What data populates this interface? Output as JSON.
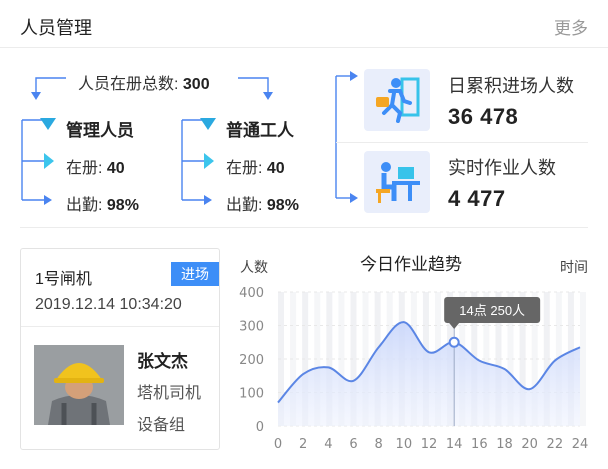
{
  "header": {
    "title": "人员管理",
    "more": "更多"
  },
  "totals": {
    "label": "人员在册总数: ",
    "value": "300"
  },
  "groups": [
    {
      "name": "管理人员",
      "registered_label": "在册: ",
      "registered": "40",
      "attendance_label": "出勤: ",
      "attendance": "98%"
    },
    {
      "name": "普通工人",
      "registered_label": "在册: ",
      "registered": "40",
      "attendance_label": "出勤: ",
      "attendance": "98%"
    }
  ],
  "summary": [
    {
      "label": "日累积进场人数",
      "value": "36 478",
      "icon": "entering-person-icon"
    },
    {
      "label": "实时作业人数",
      "value": "4 477",
      "icon": "worker-at-desk-icon"
    }
  ],
  "gate": {
    "name": "1号闸机",
    "status": "进场",
    "timestamp": "2019.12.14 10:34:20",
    "person_name": "张文杰",
    "person_role": "塔机司机",
    "person_group": "设备组"
  },
  "colors": {
    "accent": "#3d8ef7",
    "line": "#5b86e5",
    "fill": "#dfe6fb",
    "tooltip": "#666666"
  },
  "chart_data": {
    "type": "area",
    "title": "今日作业趋势",
    "ylabel": "人数",
    "xlabel": "时间",
    "ylim": [
      0,
      400
    ],
    "yticks": [
      0,
      100,
      200,
      300,
      400
    ],
    "x": [
      0,
      2,
      4,
      6,
      8,
      10,
      12,
      14,
      16,
      18,
      20,
      22,
      24
    ],
    "xtick_labels": [
      "0",
      "2",
      "4",
      "6",
      "8",
      "10",
      "12",
      "14",
      "16",
      "18",
      "20",
      "22",
      "24"
    ],
    "series": [
      {
        "values": [
          70,
          155,
          175,
          135,
          235,
          310,
          220,
          250,
          195,
          170,
          110,
          195,
          235
        ]
      }
    ],
    "tooltip": {
      "x": 14,
      "text": "14点 250人"
    },
    "grid": true
  }
}
